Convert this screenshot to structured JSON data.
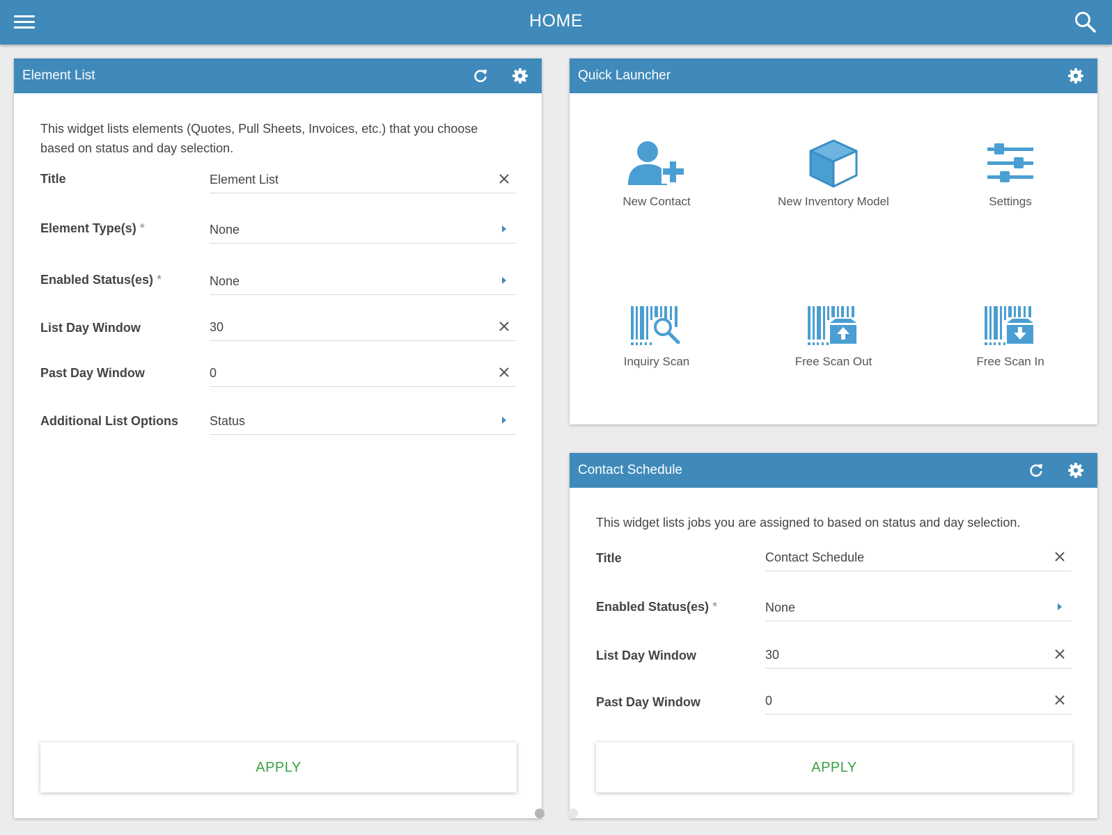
{
  "topbar": {
    "title": "HOME",
    "menu_icon": "hamburger-menu-icon",
    "search_icon": "search-icon",
    "color": "#3f8aba"
  },
  "element_list": {
    "header": "Element List",
    "description": "This widget lists elements (Quotes, Pull Sheets, Invoices, etc.) that you choose based on status and day selection.",
    "fields": [
      {
        "label": "Title",
        "required": false,
        "value": "Element List",
        "control": "clear"
      },
      {
        "label": "Element Type(s)",
        "required": true,
        "value": "None",
        "control": "arrow"
      },
      {
        "label": "Enabled Status(es)",
        "required": true,
        "value": "None",
        "control": "arrow"
      },
      {
        "label": "List Day Window",
        "required": false,
        "value": "30",
        "control": "clear"
      },
      {
        "label": "Past Day Window",
        "required": false,
        "value": "0",
        "control": "clear"
      },
      {
        "label": "Additional List Options",
        "required": false,
        "value": "Status",
        "control": "arrow"
      }
    ],
    "apply_label": "APPLY"
  },
  "quick_launcher": {
    "header": "Quick Launcher",
    "items": [
      {
        "label": "New Contact",
        "icon": "add-contact-icon"
      },
      {
        "label": "New Inventory Model",
        "icon": "box-icon"
      },
      {
        "label": "Settings",
        "icon": "sliders-icon"
      },
      {
        "label": "Inquiry Scan",
        "icon": "barcode-search-icon"
      },
      {
        "label": "Free Scan Out",
        "icon": "barcode-upload-icon"
      },
      {
        "label": "Free Scan In",
        "icon": "barcode-download-icon"
      }
    ]
  },
  "contact_schedule": {
    "header": "Contact Schedule",
    "description": "This widget lists jobs you are assigned to based on status and day selection.",
    "fields": [
      {
        "label": "Title",
        "required": false,
        "value": "Contact Schedule",
        "control": "clear"
      },
      {
        "label": "Enabled Status(es)",
        "required": true,
        "value": "None",
        "control": "arrow"
      },
      {
        "label": "List Day Window",
        "required": false,
        "value": "30",
        "control": "clear"
      },
      {
        "label": "Past Day Window",
        "required": false,
        "value": "0",
        "control": "clear"
      }
    ],
    "apply_label": "APPLY"
  },
  "required_marker": "*",
  "colors": {
    "accent": "#3f8aba",
    "apply_text": "#3aa043",
    "icon_blue": "#4a9ed2"
  }
}
